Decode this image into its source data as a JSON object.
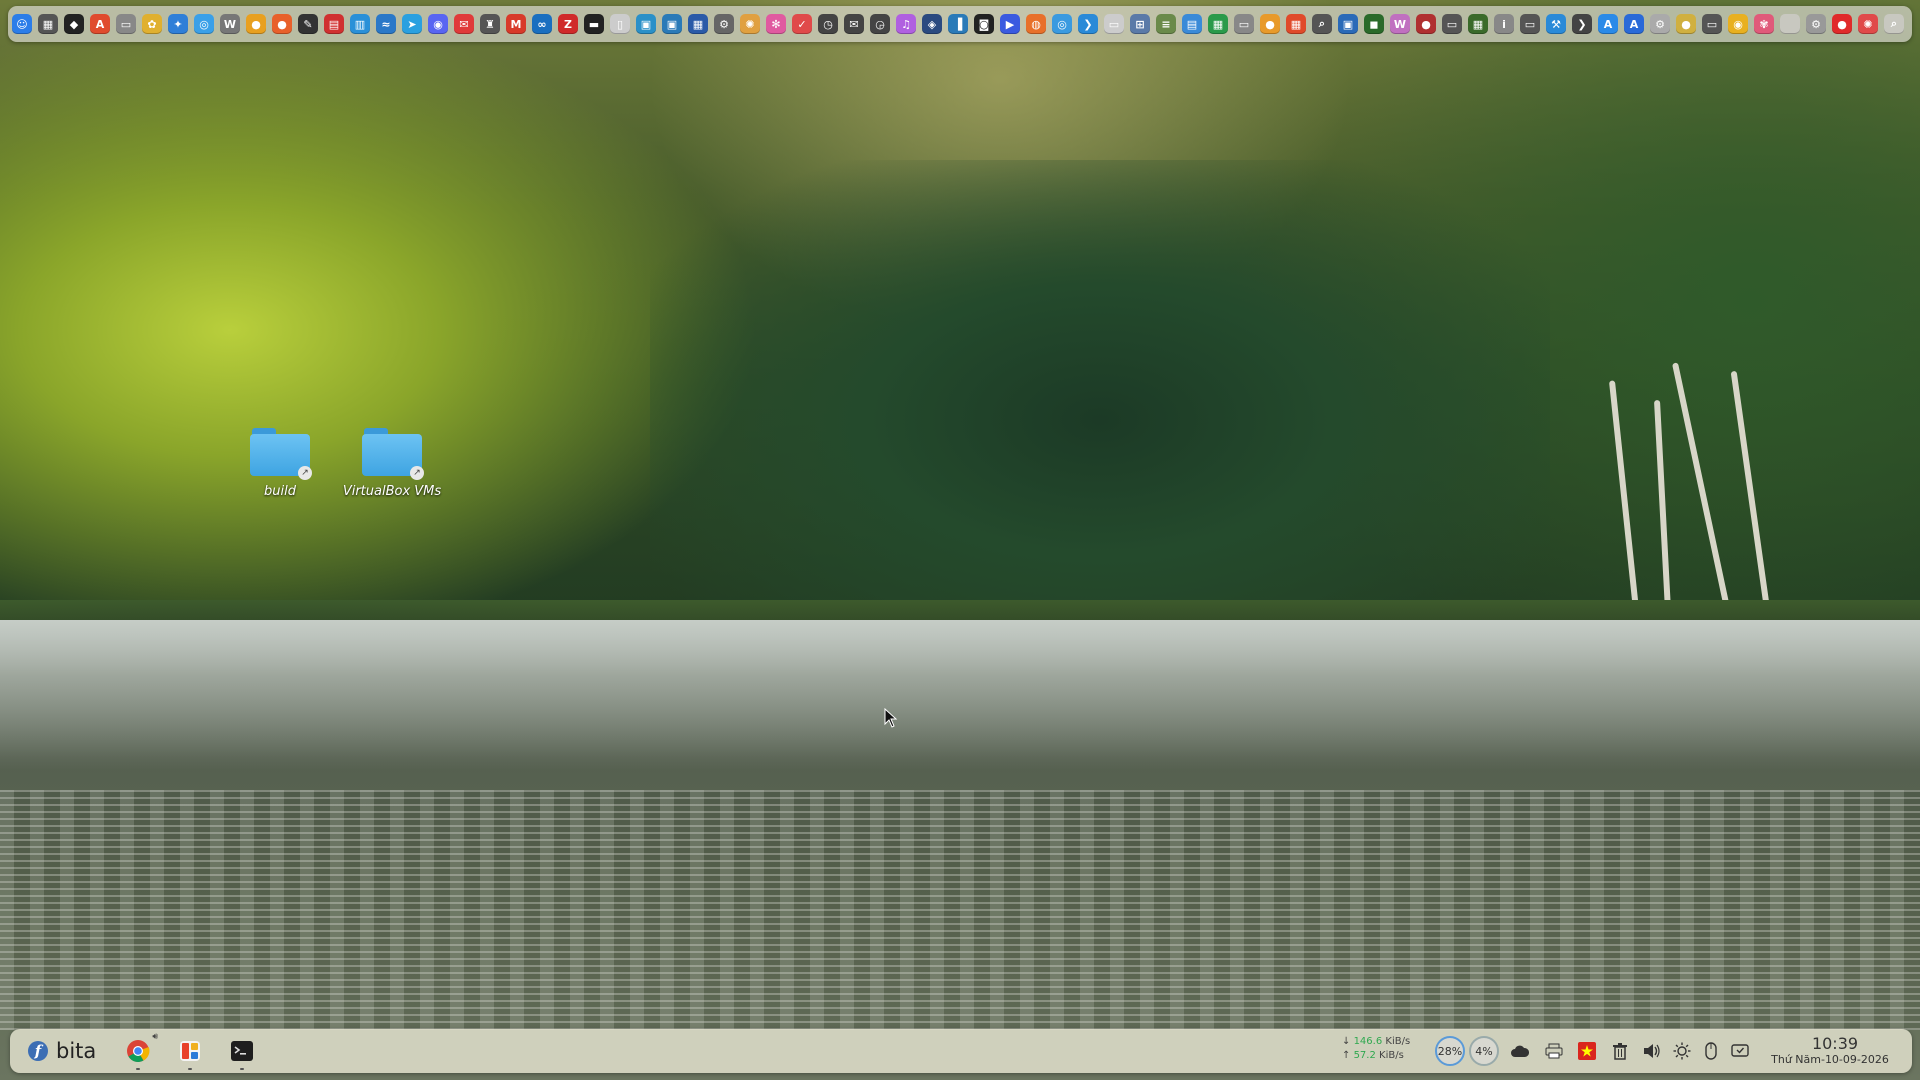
{
  "top_dock": {
    "apps": [
      {
        "icon": "finder-icon",
        "color": "#2b7de9",
        "glyph": "☺"
      },
      {
        "icon": "calculator-icon",
        "color": "#555555",
        "glyph": "▦"
      },
      {
        "icon": "linux-tux-icon",
        "color": "#222222",
        "glyph": "◆"
      },
      {
        "icon": "app-store-icon",
        "color": "#e04b2e",
        "glyph": "A"
      },
      {
        "icon": "disk-icon",
        "color": "#888888",
        "glyph": "▭"
      },
      {
        "icon": "butterfly-icon",
        "color": "#e0b030",
        "glyph": "✿"
      },
      {
        "icon": "compass-icon",
        "color": "#2f7fd8",
        "glyph": "✦"
      },
      {
        "icon": "safari-icon",
        "color": "#3aa0e8",
        "glyph": "◎"
      },
      {
        "icon": "wiki-icon",
        "color": "#777777",
        "glyph": "W"
      },
      {
        "icon": "chrome-icon",
        "color": "#e8a020",
        "glyph": "●"
      },
      {
        "icon": "firefox-icon",
        "color": "#e8602a",
        "glyph": "●"
      },
      {
        "icon": "inkscape-icon",
        "color": "#333333",
        "glyph": "✎"
      },
      {
        "icon": "pdf-icon",
        "color": "#d03030",
        "glyph": "▤"
      },
      {
        "icon": "grid-app-icon",
        "color": "#2a90d8",
        "glyph": "▥"
      },
      {
        "icon": "wave-icon",
        "color": "#2a78c8",
        "glyph": "≈"
      },
      {
        "icon": "telegram-icon",
        "color": "#2aa0e0",
        "glyph": "➤"
      },
      {
        "icon": "discord-icon",
        "color": "#5865f2",
        "glyph": "◉"
      },
      {
        "icon": "mail-icon",
        "color": "#e03a3a",
        "glyph": "✉"
      },
      {
        "icon": "gift-icon",
        "color": "#555555",
        "glyph": "♜"
      },
      {
        "icon": "gmail-icon",
        "color": "#d83a2a",
        "glyph": "M"
      },
      {
        "icon": "sync-icon",
        "color": "#1a6fc0",
        "glyph": "∞"
      },
      {
        "icon": "filezilla-icon",
        "color": "#d02a2a",
        "glyph": "Z"
      },
      {
        "icon": "terminal-icon",
        "color": "#222222",
        "glyph": "▬"
      },
      {
        "icon": "notebook-icon",
        "color": "#cccccc",
        "glyph": "▯"
      },
      {
        "icon": "preview-icon",
        "color": "#2a90c8",
        "glyph": "▣"
      },
      {
        "icon": "monitor-icon",
        "color": "#2a7ab8",
        "glyph": "▣"
      },
      {
        "icon": "blueprint-icon",
        "color": "#2a5aa8",
        "glyph": "▦"
      },
      {
        "icon": "settings-icon",
        "color": "#666666",
        "glyph": "⚙"
      },
      {
        "icon": "photos-icon",
        "color": "#e0a040",
        "glyph": "✺"
      },
      {
        "icon": "pinwheel-icon",
        "color": "#e05aa0",
        "glyph": "✻"
      },
      {
        "icon": "tasks-icon",
        "color": "#e04a4a",
        "glyph": "✓"
      },
      {
        "icon": "clock-icon",
        "color": "#444444",
        "glyph": "◷"
      },
      {
        "icon": "mail-send-icon",
        "color": "#444444",
        "glyph": "✉"
      },
      {
        "icon": "clock2-icon",
        "color": "#444444",
        "glyph": "◶"
      },
      {
        "icon": "music-icon",
        "color": "#b060e0",
        "glyph": "♫"
      },
      {
        "icon": "vpn-icon",
        "color": "#2a4a80",
        "glyph": "◈"
      },
      {
        "icon": "sidebar-icon",
        "color": "#2a7ab8",
        "glyph": "▐"
      },
      {
        "icon": "media-icon",
        "color": "#222222",
        "glyph": "◙"
      },
      {
        "icon": "video-icon",
        "color": "#3a5ae0",
        "glyph": "▶"
      },
      {
        "icon": "ubuntu-icon",
        "color": "#e8702a",
        "glyph": "◍"
      },
      {
        "icon": "browser-icon",
        "color": "#3a9ae0",
        "glyph": "◎"
      },
      {
        "icon": "vscode-icon",
        "color": "#2a8ad8",
        "glyph": "❯"
      },
      {
        "icon": "notes-icon",
        "color": "#cccccc",
        "glyph": "▭"
      },
      {
        "icon": "network-icon",
        "color": "#5a7aa8",
        "glyph": "⊞"
      },
      {
        "icon": "db-icon",
        "color": "#6a8a4a",
        "glyph": "≡"
      },
      {
        "icon": "docs-icon",
        "color": "#3a8ad8",
        "glyph": "▤"
      },
      {
        "icon": "sheets-icon",
        "color": "#2a9a4a",
        "glyph": "▦"
      },
      {
        "icon": "files-icon",
        "color": "#888888",
        "glyph": "▭"
      },
      {
        "icon": "orange-app-icon",
        "color": "#e89a2a",
        "glyph": "●"
      },
      {
        "icon": "office-icon",
        "color": "#e04a2a",
        "glyph": "▦"
      },
      {
        "icon": "search-app-icon",
        "color": "#555555",
        "glyph": "⌕"
      },
      {
        "icon": "teams-icon",
        "color": "#2a6ab8",
        "glyph": "▣"
      },
      {
        "icon": "nvidia-icon",
        "color": "#2a6a2a",
        "glyph": "◼"
      },
      {
        "icon": "writer-icon",
        "color": "#c070c0",
        "glyph": "W"
      },
      {
        "icon": "record-icon",
        "color": "#b03030",
        "glyph": "●"
      },
      {
        "icon": "display-icon",
        "color": "#555555",
        "glyph": "▭"
      },
      {
        "icon": "minecraft-icon",
        "color": "#3a6a2a",
        "glyph": "▦"
      },
      {
        "icon": "info-icon",
        "color": "#888888",
        "glyph": "i"
      },
      {
        "icon": "drive-icon",
        "color": "#555555",
        "glyph": "▭"
      },
      {
        "icon": "xcode-icon",
        "color": "#2a8ad8",
        "glyph": "⚒"
      },
      {
        "icon": "arrow-icon",
        "color": "#444444",
        "glyph": "❯"
      },
      {
        "icon": "appstore-blue-icon",
        "color": "#2a8ae8",
        "glyph": "A"
      },
      {
        "icon": "font-icon",
        "color": "#2a6ad8",
        "glyph": "A"
      },
      {
        "icon": "gear2-icon",
        "color": "#aaaaaa",
        "glyph": "⚙"
      },
      {
        "icon": "coin-icon",
        "color": "#d0b040",
        "glyph": "●"
      },
      {
        "icon": "laptop-icon",
        "color": "#555555",
        "glyph": "▭"
      },
      {
        "icon": "chrome-dev-icon",
        "color": "#e8b020",
        "glyph": "◉"
      },
      {
        "icon": "flower-icon",
        "color": "#e05a7a",
        "glyph": "✾"
      },
      {
        "icon": "blank-icon",
        "color": "#c8c8c0",
        "glyph": " "
      },
      {
        "icon": "settings2-icon",
        "color": "#999999",
        "glyph": "⚙"
      },
      {
        "icon": "red-app-icon",
        "color": "#e02a2a",
        "glyph": "●"
      },
      {
        "icon": "gnome-icon",
        "color": "#e04a4a",
        "glyph": "✺"
      },
      {
        "icon": "search-icon",
        "color": "#c8c8c0",
        "glyph": "⌕"
      }
    ]
  },
  "desktop_icons": [
    {
      "label": "build"
    },
    {
      "label": "VirtualBox VMs"
    }
  ],
  "taskbar": {
    "user": "bita",
    "net_down_value": "146.6",
    "net_down_unit": "KiB/s",
    "net_up_value": "57.2",
    "net_up_unit": "KiB/s",
    "cpu_percent": "28%",
    "mem_percent": "4%",
    "time": "10:39",
    "date": "Thứ Năm-10-09-2026"
  }
}
